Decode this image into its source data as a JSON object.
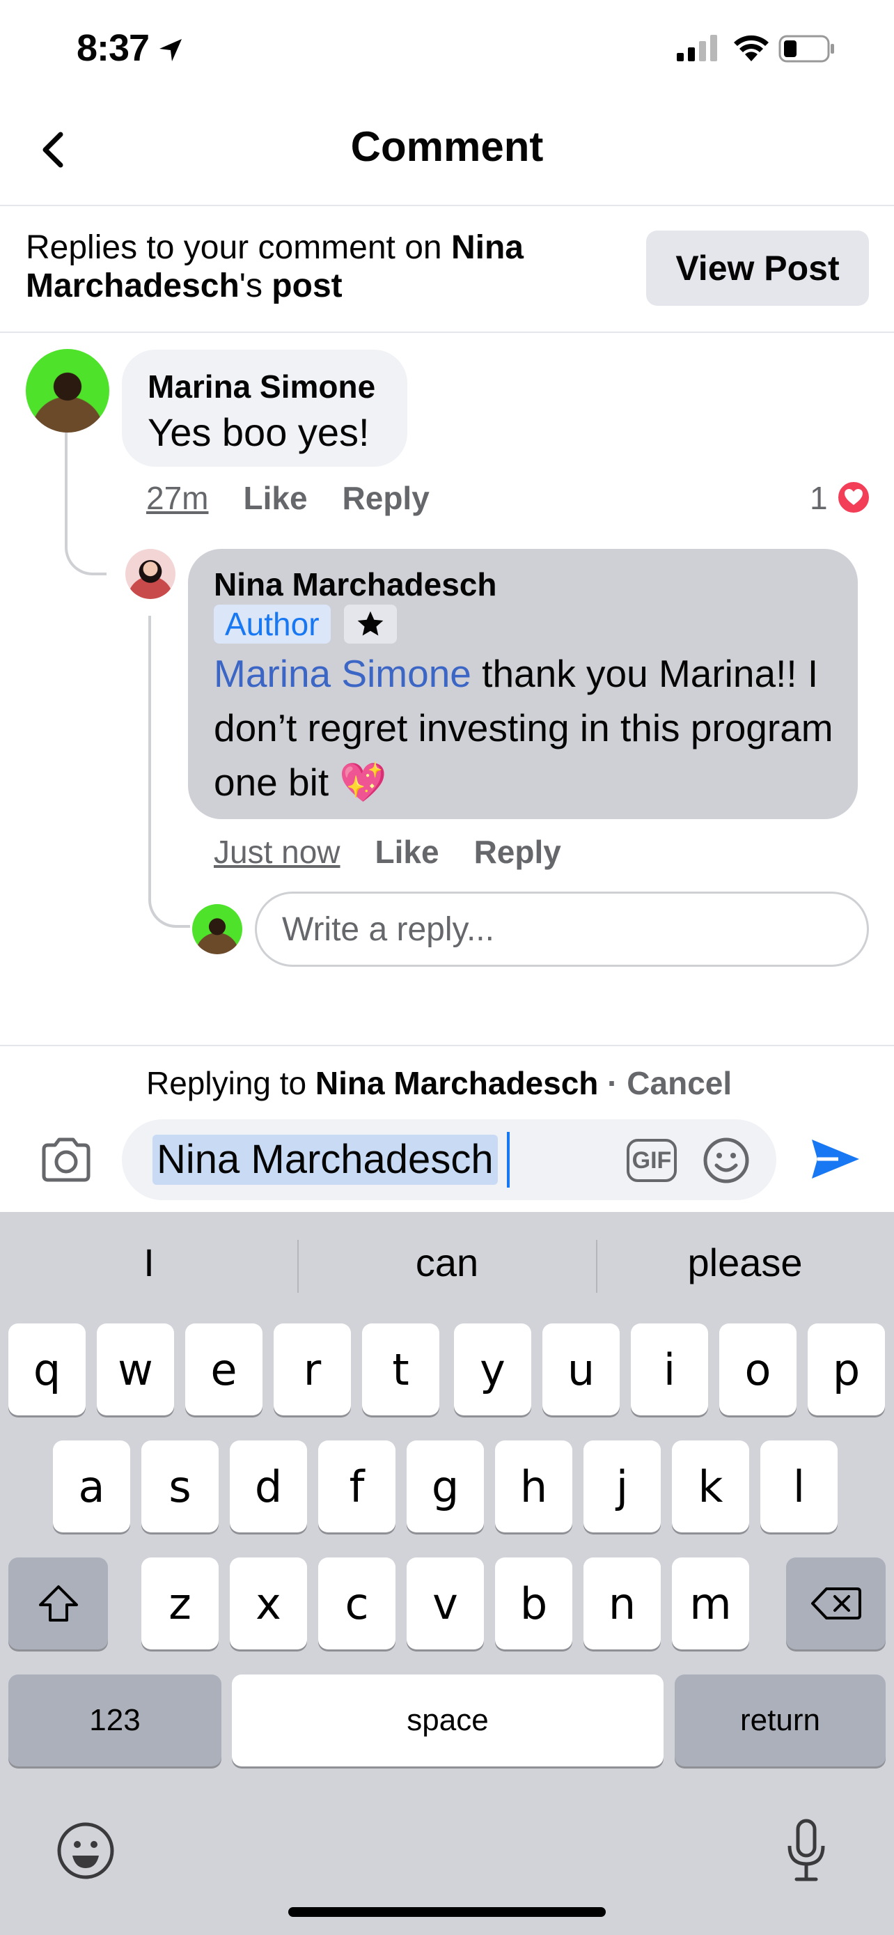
{
  "status_bar": {
    "time": "8:37"
  },
  "header": {
    "title": "Comment"
  },
  "banner": {
    "prefix": "Replies to your comment on ",
    "post_owner": "Nina Marchadesch",
    "suffix_possessive": "'s ",
    "suffix_post": "post",
    "view_post_label": "View Post"
  },
  "comment1": {
    "author": "Marina Simone",
    "text": "Yes boo yes!",
    "timestamp": "27m",
    "like_label": "Like",
    "reply_label": "Reply",
    "reaction_count": "1"
  },
  "comment2": {
    "author": "Nina Marchadesch",
    "author_badge": "Author",
    "mention": "Marina Simone",
    "text": " thank you Marina!! I don’t regret investing in this program one bit 💖",
    "timestamp": "Just now",
    "like_label": "Like",
    "reply_label": "Reply"
  },
  "write_reply": {
    "placeholder": "Write a reply..."
  },
  "composer": {
    "replying_prefix": "Replying to ",
    "replying_name": "Nina Marchadesch",
    "separator": " · ",
    "cancel_label": "Cancel",
    "value": "Nina Marchadesch",
    "gif_label": "GIF"
  },
  "keyboard": {
    "suggestions": [
      "I",
      "can",
      "please"
    ],
    "row1": [
      "q",
      "w",
      "e",
      "r",
      "t",
      "y",
      "u",
      "i",
      "o",
      "p"
    ],
    "row2": [
      "a",
      "s",
      "d",
      "f",
      "g",
      "h",
      "j",
      "k",
      "l"
    ],
    "row3": [
      "z",
      "x",
      "c",
      "v",
      "b",
      "n",
      "m"
    ],
    "numbers_label": "123",
    "space_label": "space",
    "return_label": "return"
  },
  "colors": {
    "accent": "#1877f2",
    "mention": "#3b66c5",
    "heart": "#f33e58",
    "bubble_light": "#f0f2f5",
    "bubble_selected": "#cfd0d5",
    "keyboard_bg": "#d1d3d9"
  },
  "icons": [
    "location-arrow-icon",
    "signal-icon",
    "wifi-icon",
    "battery-icon",
    "back-chevron-icon",
    "heart-icon",
    "star-icon",
    "camera-icon",
    "emoji-icon",
    "send-icon",
    "shift-icon",
    "backspace-icon",
    "emoji-keyboard-icon",
    "microphone-icon"
  ]
}
